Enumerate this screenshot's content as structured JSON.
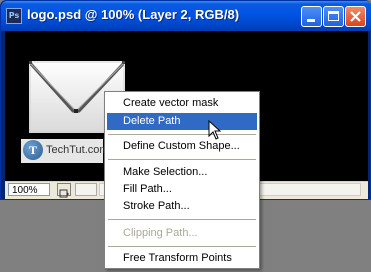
{
  "window": {
    "title": "logo.psd @ 100% (Layer 2, RGB/8)",
    "app_icon_text": "Ps",
    "accent": "#0054e3"
  },
  "status": {
    "zoom": "100%"
  },
  "logo": {
    "letter": "T",
    "text": "TechTut.com"
  },
  "context_menu": {
    "items": [
      {
        "label": "Create vector mask",
        "highlighted": false,
        "disabled": false
      },
      {
        "label": "Delete Path",
        "highlighted": true,
        "disabled": false
      },
      {
        "label": "Define Custom Shape...",
        "highlighted": false,
        "disabled": false
      },
      {
        "label": "Make Selection...",
        "highlighted": false,
        "disabled": false
      },
      {
        "label": "Fill Path...",
        "highlighted": false,
        "disabled": false
      },
      {
        "label": "Stroke Path...",
        "highlighted": false,
        "disabled": false
      },
      {
        "label": "Clipping Path...",
        "highlighted": false,
        "disabled": true
      },
      {
        "label": "Free Transform Points",
        "highlighted": false,
        "disabled": false
      }
    ],
    "highlight_color": "#316ac5"
  }
}
